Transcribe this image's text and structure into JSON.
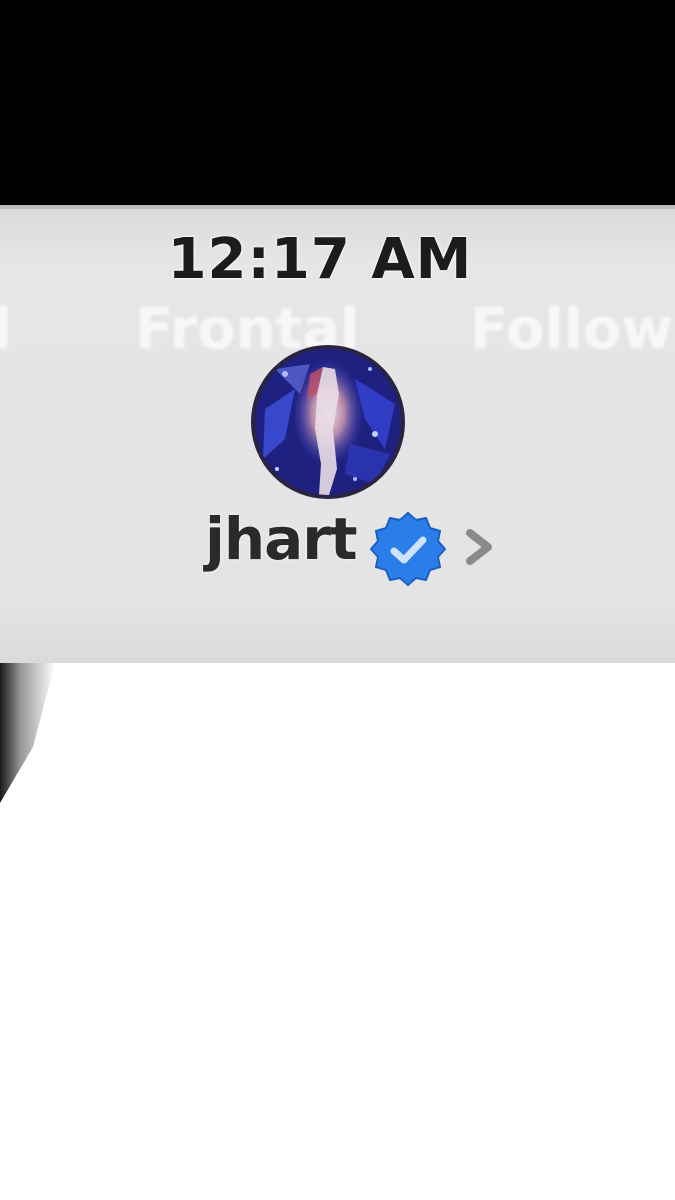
{
  "status_bar": {
    "time": "12:17 AM"
  },
  "tabs": [
    {
      "label": "al"
    },
    {
      "label": "Frontal"
    },
    {
      "label": "Follow"
    }
  ],
  "profile": {
    "username": "jhart",
    "verified": true,
    "avatar_icon": "profile-avatar"
  },
  "icons": {
    "verified": "verified-badge-icon",
    "chevron": "chevron-right-icon"
  },
  "colors": {
    "top_bar": "#000000",
    "header_bg": "#e3e3e3",
    "verified_badge": "#2b7de9",
    "chevron": "#8a8a8a",
    "username": "#2a2a2a"
  }
}
